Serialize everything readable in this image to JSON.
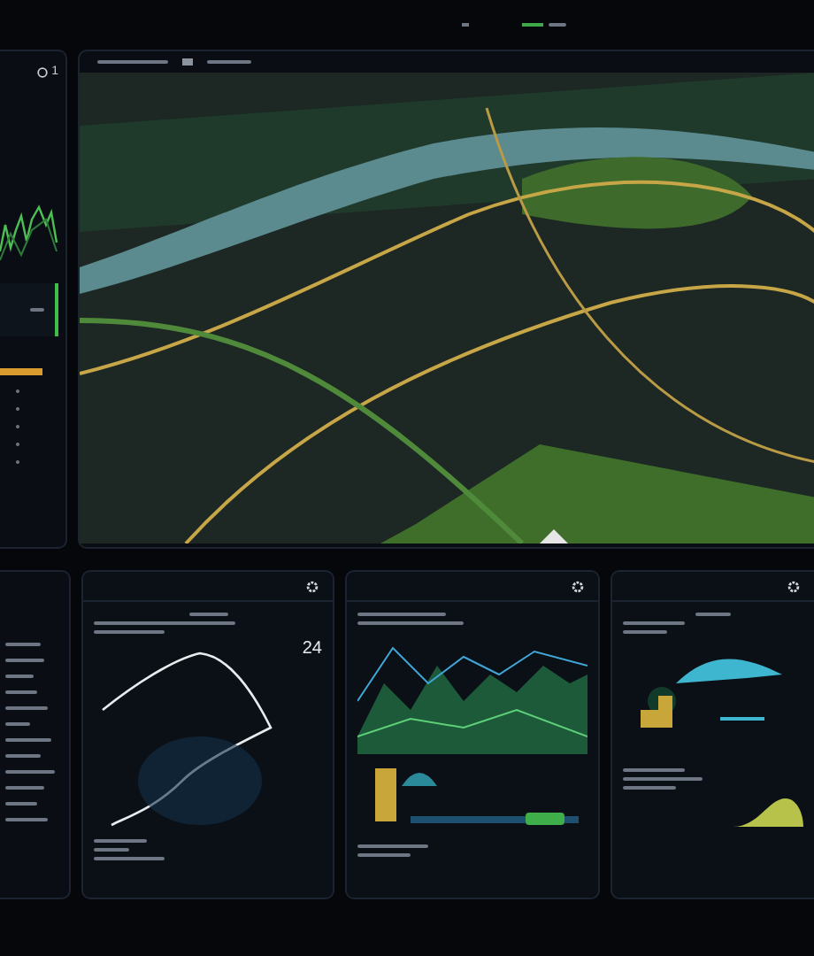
{
  "side_panel": {
    "count": "1"
  },
  "route_card": {
    "value": "24"
  }
}
